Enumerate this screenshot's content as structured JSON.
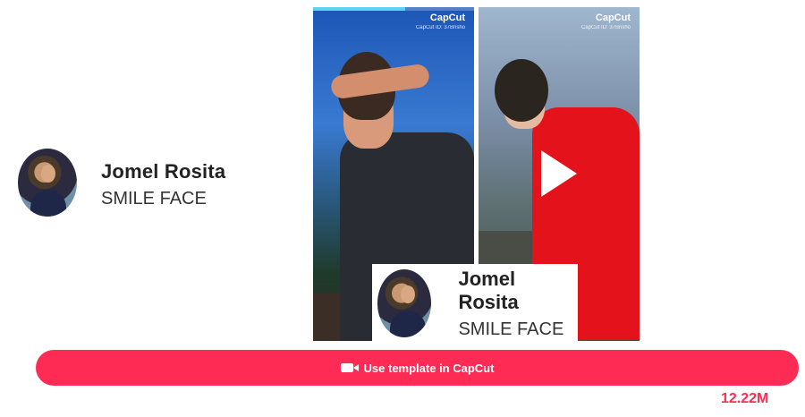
{
  "creator": {
    "name": "Jomel Rosita",
    "template_name": "SMILE FACE"
  },
  "video_preview": {
    "watermark_brand": "CapCut",
    "watermark_id": "CapCut ID: 37Bnsho",
    "progress_fraction": 0.57
  },
  "overlay_card": {
    "name": "Jomel Rosita",
    "template_name": "SMILE FACE"
  },
  "cta": {
    "label": "Use template in CapCut",
    "icon": "video-camera-icon"
  },
  "usage_count": "12.22M",
  "colors": {
    "accent": "#fe2c55",
    "progress": "#5ad0f5"
  }
}
